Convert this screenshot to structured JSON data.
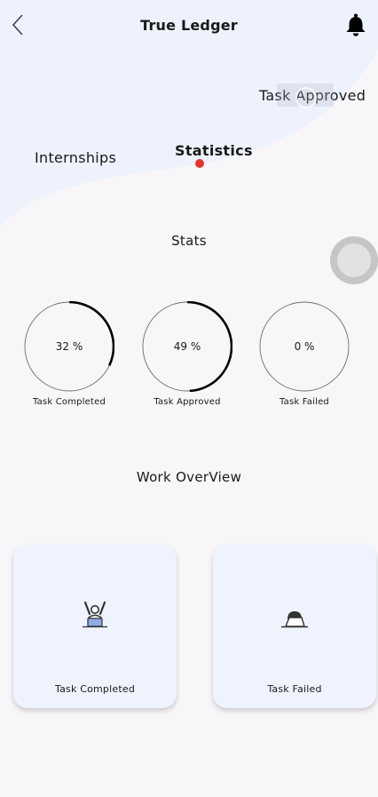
{
  "header": {
    "title": "True Ledger",
    "back_icon": "chevron-left-icon",
    "bell_icon": "bell-icon"
  },
  "menu": {
    "task_approved": "Task Approved",
    "internships": "Internships",
    "statistics": "Statistics",
    "active_item": "Statistics",
    "active_dot_color": "#e3342a"
  },
  "stats": {
    "heading": "Stats",
    "items": [
      {
        "label": "Task Completed",
        "percent": 32,
        "display": "32 %"
      },
      {
        "label": "Task Approved",
        "percent": 49,
        "display": "49 %"
      },
      {
        "label": "Task Failed",
        "percent": 0,
        "display": "0 %"
      }
    ]
  },
  "overview": {
    "heading": "Work OverView",
    "cards": [
      {
        "label": "Task Completed",
        "icon": "celebrating-person-laptop-icon"
      },
      {
        "label": "Task Failed",
        "icon": "person-hidden-behind-laptop-icon"
      }
    ]
  },
  "colors": {
    "background": "#f8f6f9",
    "header_wave": "#edf2fc",
    "card_background": "#eef3fd",
    "ring_progress": "#000000",
    "ring_track": "#6e6e6e"
  }
}
